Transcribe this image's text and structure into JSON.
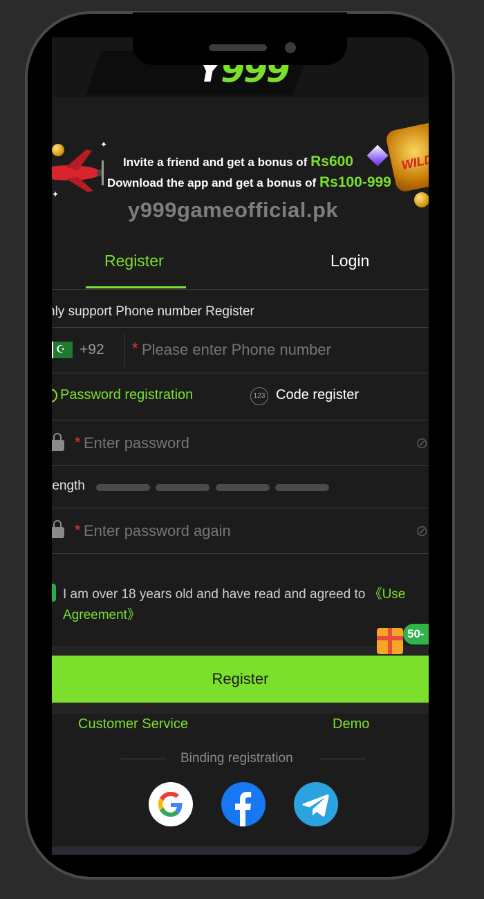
{
  "logo": {
    "prefix": "Y",
    "highlight": "999"
  },
  "banner": {
    "line1_text": "Invite a friend and get a bonus of ",
    "line1_highlight": "Rs600",
    "line2_text": "Download the app and get a bonus of ",
    "line2_highlight": "Rs100-999",
    "wild_label": "WILD"
  },
  "watermark": "y999gameofficial.pk",
  "tabs": {
    "register": "Register",
    "login": "Login"
  },
  "form": {
    "notice": "nly support Phone number Register",
    "country_code": "+92",
    "phone_placeholder": "Please enter Phone number",
    "required_mark": "*",
    "option_password": "Password registration",
    "option_code_icon": "123",
    "option_code": "Code register",
    "password_placeholder": "Enter password",
    "strength_label": "rength",
    "password_again_placeholder": "Enter password again",
    "agreement_text": "I am over 18 years old and have read and agreed to ",
    "agreement_link_part1": "《Use",
    "agreement_link_part2": "Agreement》",
    "gift_badge": "50-",
    "register_button": "Register"
  },
  "links": {
    "customer_service": "Customer Service",
    "demo": "Demo"
  },
  "binding": {
    "label": "Binding registration"
  },
  "social": [
    "google-icon",
    "facebook-icon",
    "telegram-icon"
  ],
  "colors": {
    "accent": "#7be02c",
    "background": "#1c1c1c",
    "required": "#e23b3b"
  }
}
